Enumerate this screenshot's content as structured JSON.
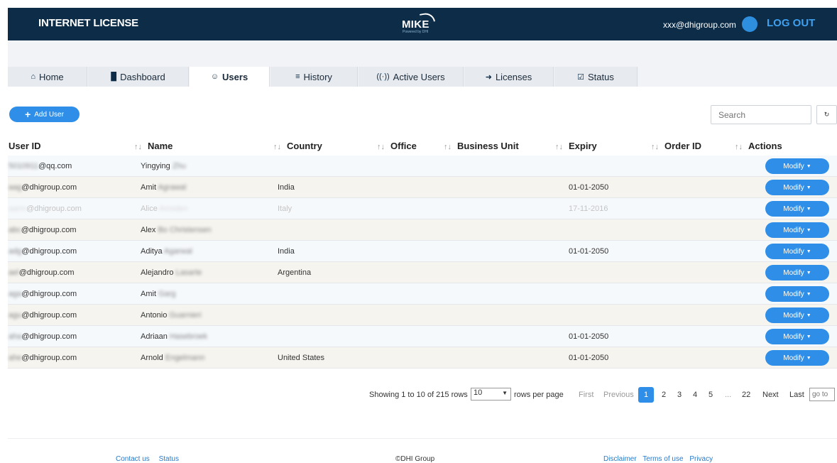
{
  "header": {
    "brand": "INTERNET LICENSE",
    "logo_text": "MIKE",
    "logo_sub": "Powered by DHI",
    "user_email": "xxx@dhigroup.com",
    "logout_label": "LOG OUT"
  },
  "tabs": [
    {
      "label": "Home",
      "icon": "home-icon",
      "glyph": "⌂",
      "active": false
    },
    {
      "label": "Dashboard",
      "icon": "dashboard-icon",
      "glyph": "█",
      "active": false
    },
    {
      "label": "Users",
      "icon": "user-icon",
      "glyph": "☺",
      "active": true
    },
    {
      "label": "History",
      "icon": "list-icon",
      "glyph": "≡",
      "active": false
    },
    {
      "label": "Active Users",
      "icon": "signal-icon",
      "glyph": "((·))",
      "active": false
    },
    {
      "label": "Licenses",
      "icon": "tags-icon",
      "glyph": "➜",
      "active": false
    },
    {
      "label": "Status",
      "icon": "check-square-icon",
      "glyph": "☑",
      "active": false
    }
  ],
  "toolbar": {
    "add_user_label": "Add User",
    "search_placeholder": "Search"
  },
  "table": {
    "columns": [
      "User ID",
      "Name",
      "Country",
      "Office",
      "Business Unit",
      "Expiry",
      "Order ID",
      "Actions"
    ],
    "modify_label": "Modify",
    "rows": [
      {
        "user_id_hidden": "5010911",
        "user_id": "@qq.com",
        "first_name": "Yingying",
        "last_name": "Zhu",
        "country": "",
        "office": "",
        "business_unit": "",
        "expiry": "",
        "order_id": "",
        "dim": false
      },
      {
        "user_id_hidden": "aag",
        "user_id": "@dhigroup.com",
        "first_name": "Amit",
        "last_name": "Agrawal",
        "country": "India",
        "office": "",
        "business_unit": "",
        "expiry": "01-01-2050",
        "order_id": "",
        "dim": false
      },
      {
        "user_id_hidden": "aarm",
        "user_id": "@dhigroup.com",
        "first_name": "Alice",
        "last_name": "Amsden",
        "country": "Italy",
        "office": "",
        "business_unit": "",
        "expiry": "17-11-2016",
        "order_id": "",
        "dim": true
      },
      {
        "user_id_hidden": "abc",
        "user_id": "@dhigroup.com",
        "first_name": "Alex",
        "last_name": "Bo Christensen",
        "country": "",
        "office": "",
        "business_unit": "",
        "expiry": "",
        "order_id": "",
        "dim": false
      },
      {
        "user_id_hidden": "adg",
        "user_id": "@dhigroup.com",
        "first_name": "Aditya",
        "last_name": "Agarwal",
        "country": "India",
        "office": "",
        "business_unit": "",
        "expiry": "01-01-2050",
        "order_id": "",
        "dim": false
      },
      {
        "user_id_hidden": "ael",
        "user_id": "@dhigroup.com",
        "first_name": "Alejandro",
        "last_name": "Lasarte",
        "country": "Argentina",
        "office": "",
        "business_unit": "",
        "expiry": "",
        "order_id": "",
        "dim": false
      },
      {
        "user_id_hidden": "aga",
        "user_id": "@dhigroup.com",
        "first_name": "Amit",
        "last_name": "Garg",
        "country": "",
        "office": "",
        "business_unit": "",
        "expiry": "",
        "order_id": "",
        "dim": false
      },
      {
        "user_id_hidden": "agu",
        "user_id": "@dhigroup.com",
        "first_name": "Antonio",
        "last_name": "Guarnieri",
        "country": "",
        "office": "",
        "business_unit": "",
        "expiry": "",
        "order_id": "",
        "dim": false
      },
      {
        "user_id_hidden": "aha",
        "user_id": "@dhigroup.com",
        "first_name": "Adriaan",
        "last_name": "Hasebroek",
        "country": "",
        "office": "",
        "business_unit": "",
        "expiry": "01-01-2050",
        "order_id": "",
        "dim": false
      },
      {
        "user_id_hidden": "ahe",
        "user_id": "@dhigroup.com",
        "first_name": "Arnold",
        "last_name": "Engelmann",
        "country": "United States",
        "office": "",
        "business_unit": "",
        "expiry": "01-01-2050",
        "order_id": "",
        "dim": false
      }
    ]
  },
  "pagination": {
    "showing_text": "Showing 1 to 10 of 215 rows",
    "per_page_value": "10",
    "per_page_suffix": "rows per page",
    "first_label": "First",
    "previous_label": "Previous",
    "pages": [
      "1",
      "2",
      "3",
      "4",
      "5",
      "...",
      "22"
    ],
    "current_page": "1",
    "next_label": "Next",
    "last_label": "Last",
    "goto_placeholder": "go to"
  },
  "footer": {
    "left_links": [
      "Contact us",
      "Status"
    ],
    "copyright": "©DHI Group",
    "right_links": [
      "Disclaimer",
      "Terms of use",
      "Privacy"
    ]
  }
}
